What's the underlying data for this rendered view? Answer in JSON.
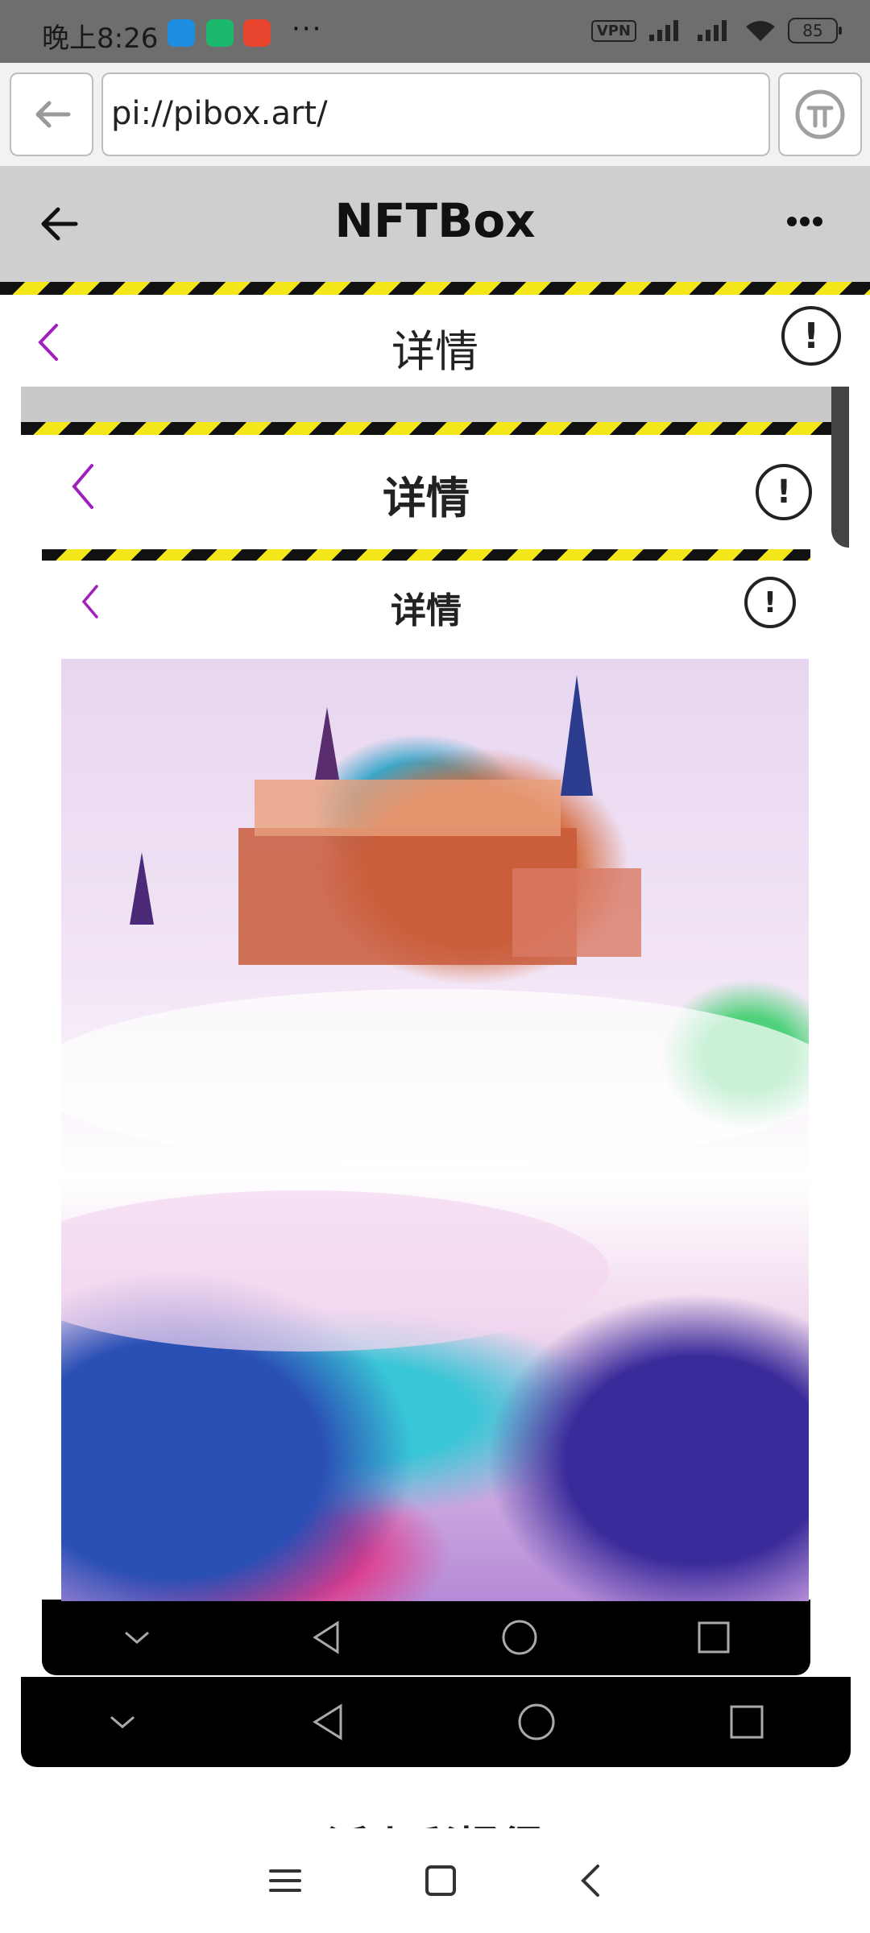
{
  "status_bar": {
    "time": "晚上8:26",
    "more": "···",
    "vpn": "VPN",
    "battery": "85",
    "icons": [
      "app-icon-1",
      "app-icon-2",
      "taobao-icon",
      "signal-icon",
      "signal-icon",
      "wifi-icon",
      "battery-icon"
    ]
  },
  "browser": {
    "url": "pi://pibox.art/"
  },
  "app": {
    "title": "NFTBox"
  },
  "detail": {
    "title": "详情"
  },
  "caption_partial": "派上彩橘得",
  "colors": {
    "accent_purple": "#a21fbf",
    "stripe_yellow": "#f3e71a",
    "stripe_black": "#111111"
  }
}
